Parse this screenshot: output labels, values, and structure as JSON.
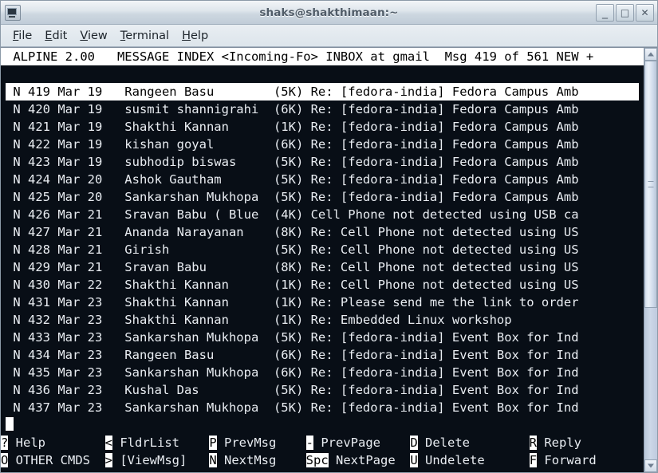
{
  "window": {
    "title": "shaks@shakthimaan:~",
    "icon": "terminal-icon",
    "buttons": {
      "minimize": "_",
      "maximize": "□",
      "close": "✕"
    }
  },
  "menubar": {
    "items": [
      {
        "label": "File",
        "mnemonic": "F"
      },
      {
        "label": "Edit",
        "mnemonic": "E"
      },
      {
        "label": "View",
        "mnemonic": "V"
      },
      {
        "label": "Terminal",
        "mnemonic": "T"
      },
      {
        "label": "Help",
        "mnemonic": "H"
      }
    ]
  },
  "alpine": {
    "status_line": " ALPINE 2.00   MESSAGE INDEX <Incoming-Fo> INBOX at gmail  Msg 419 of 561 NEW +",
    "app_name": "ALPINE",
    "version": "2.00",
    "screen": "MESSAGE INDEX",
    "folder_collection": "<Incoming-Fo>",
    "folder": "INBOX at gmail",
    "msg_current": 419,
    "msg_total": 561,
    "msg_flag": "NEW +",
    "columns": [
      "status",
      "number",
      "date",
      "sender",
      "size",
      "subject"
    ],
    "messages": [
      {
        "status": "N",
        "number": "419",
        "date": "Mar 19",
        "sender": "Rangeen Basu",
        "size": "(5K)",
        "subject": "Re: [fedora-india] Fedora Campus Amb",
        "selected": true
      },
      {
        "status": "N",
        "number": "420",
        "date": "Mar 19",
        "sender": "susmit shannigrahi",
        "size": "(6K)",
        "subject": "Re: [fedora-india] Fedora Campus Amb",
        "selected": false
      },
      {
        "status": "N",
        "number": "421",
        "date": "Mar 19",
        "sender": "Shakthi Kannan",
        "size": "(1K)",
        "subject": "Re: [fedora-india] Fedora Campus Amb",
        "selected": false
      },
      {
        "status": "N",
        "number": "422",
        "date": "Mar 19",
        "sender": "kishan goyal",
        "size": "(6K)",
        "subject": "Re: [fedora-india] Fedora Campus Amb",
        "selected": false
      },
      {
        "status": "N",
        "number": "423",
        "date": "Mar 19",
        "sender": "subhodip biswas",
        "size": "(5K)",
        "subject": "Re: [fedora-india] Fedora Campus Amb",
        "selected": false
      },
      {
        "status": "N",
        "number": "424",
        "date": "Mar 20",
        "sender": "Ashok Gautham",
        "size": "(5K)",
        "subject": "Re: [fedora-india] Fedora Campus Amb",
        "selected": false
      },
      {
        "status": "N",
        "number": "425",
        "date": "Mar 20",
        "sender": "Sankarshan Mukhopa",
        "size": "(5K)",
        "subject": "Re: [fedora-india] Fedora Campus Amb",
        "selected": false
      },
      {
        "status": "N",
        "number": "426",
        "date": "Mar 21",
        "sender": "Sravan Babu ( Blue",
        "size": "(4K)",
        "subject": "Cell Phone not detected using USB ca",
        "selected": false
      },
      {
        "status": "N",
        "number": "427",
        "date": "Mar 21",
        "sender": "Ananda Narayanan",
        "size": "(8K)",
        "subject": "Re: Cell Phone not detected using US",
        "selected": false
      },
      {
        "status": "N",
        "number": "428",
        "date": "Mar 21",
        "sender": "Girish",
        "size": "(5K)",
        "subject": "Re: Cell Phone not detected using US",
        "selected": false
      },
      {
        "status": "N",
        "number": "429",
        "date": "Mar 21",
        "sender": "Sravan Babu",
        "size": "(8K)",
        "subject": "Re: Cell Phone not detected using US",
        "selected": false
      },
      {
        "status": "N",
        "number": "430",
        "date": "Mar 22",
        "sender": "Shakthi Kannan",
        "size": "(1K)",
        "subject": "Re: Cell Phone not detected using US",
        "selected": false
      },
      {
        "status": "N",
        "number": "431",
        "date": "Mar 23",
        "sender": "Shakthi Kannan",
        "size": "(1K)",
        "subject": "Re: Please send me the link to order",
        "selected": false
      },
      {
        "status": "N",
        "number": "432",
        "date": "Mar 23",
        "sender": "Shakthi Kannan",
        "size": "(1K)",
        "subject": "Re: Embedded Linux workshop",
        "selected": false
      },
      {
        "status": "N",
        "number": "433",
        "date": "Mar 23",
        "sender": "Sankarshan Mukhopa",
        "size": "(5K)",
        "subject": "Re: [fedora-india] Event Box for Ind",
        "selected": false
      },
      {
        "status": "N",
        "number": "434",
        "date": "Mar 23",
        "sender": "Rangeen Basu",
        "size": "(6K)",
        "subject": "Re: [fedora-india] Event Box for Ind",
        "selected": false
      },
      {
        "status": "N",
        "number": "435",
        "date": "Mar 23",
        "sender": "Sankarshan Mukhopa",
        "size": "(6K)",
        "subject": "Re: [fedora-india] Event Box for Ind",
        "selected": false
      },
      {
        "status": "N",
        "number": "436",
        "date": "Mar 23",
        "sender": "Kushal Das",
        "size": "(5K)",
        "subject": "Re: [fedora-india] Event Box for Ind",
        "selected": false
      },
      {
        "status": "N",
        "number": "437",
        "date": "Mar 23",
        "sender": "Sankarshan Mukhopa",
        "size": "(5K)",
        "subject": "Re: [fedora-india] Event Box for Ind",
        "selected": false
      }
    ],
    "commands_row1": [
      {
        "key": "?",
        "label": "Help"
      },
      {
        "key": "<",
        "label": "FldrList"
      },
      {
        "key": "P",
        "label": "PrevMsg"
      },
      {
        "key": "-",
        "label": "PrevPage"
      },
      {
        "key": "D",
        "label": "Delete"
      },
      {
        "key": "R",
        "label": "Reply"
      }
    ],
    "commands_row2": [
      {
        "key": "O",
        "label": "OTHER CMDS"
      },
      {
        "key": ">",
        "label": "[ViewMsg]"
      },
      {
        "key": "N",
        "label": "NextMsg"
      },
      {
        "key": "Spc",
        "label": "NextPage"
      },
      {
        "key": "U",
        "label": "Undelete"
      },
      {
        "key": "F",
        "label": "Forward"
      }
    ]
  },
  "colors": {
    "terminal_bg": "#080e16",
    "terminal_fg": "#e9edf2",
    "inverse_bg": "#ffffff",
    "inverse_fg": "#000000",
    "titlebar": "#dfe6ec",
    "scrollbar": "#c4d0e0"
  }
}
